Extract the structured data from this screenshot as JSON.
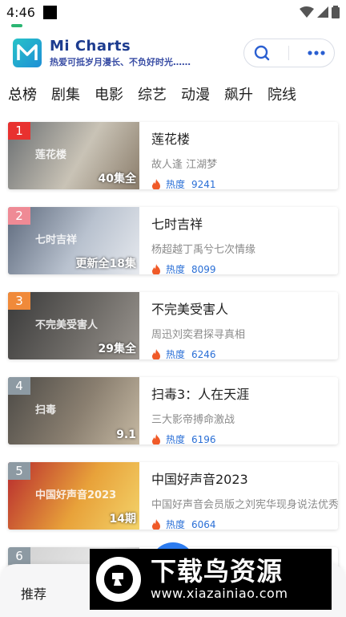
{
  "status": {
    "time": "4:46"
  },
  "header": {
    "app_name": "Mi Charts",
    "tagline": "热爱可抵岁月漫长、不负好时光……",
    "search_icon": "search-icon",
    "more_icon": "more-dots-icon"
  },
  "tabs": [
    {
      "label": "总榜",
      "active": true
    },
    {
      "label": "剧集"
    },
    {
      "label": "电影"
    },
    {
      "label": "综艺"
    },
    {
      "label": "动漫"
    },
    {
      "label": "飙升"
    },
    {
      "label": "院线"
    }
  ],
  "items": [
    {
      "rank": "1",
      "rank_color": "#e8312f",
      "title": "莲花楼",
      "subtitle": "故人逢 江湖梦",
      "episodes": "40集全",
      "heat_label": "热度",
      "heat": "9241",
      "poster_text": "莲花楼",
      "poster_colors": [
        "#6b6f72",
        "#c9c3b6",
        "#8b7d6b"
      ]
    },
    {
      "rank": "2",
      "rank_color": "#ef8a95",
      "title": "七时吉祥",
      "subtitle": "杨超越丁禹兮七次情缘",
      "episodes": "更新全18集",
      "heat_label": "热度",
      "heat": "8099",
      "poster_text": "七时吉祥",
      "poster_colors": [
        "#5e6a7d",
        "#b9c2cf",
        "#e6e9ee"
      ]
    },
    {
      "rank": "3",
      "rank_color": "#f08a3a",
      "title": "不完美受害人",
      "subtitle": "周迅刘奕君探寻真相",
      "episodes": "29集全",
      "heat_label": "热度",
      "heat": "6246",
      "poster_text": "不完美受害人",
      "poster_colors": [
        "#3a3a3a",
        "#6d6a66",
        "#9a958f"
      ]
    },
    {
      "rank": "4",
      "rank_color": "#8d9aa3",
      "title": "扫毒3：人在天涯",
      "subtitle": "三大影帝搏命激战",
      "episodes": "9.1",
      "heat_label": "热度",
      "heat": "6196",
      "poster_text": "扫毒",
      "poster_colors": [
        "#4c4a46",
        "#8a7f70",
        "#c6b9a3"
      ]
    },
    {
      "rank": "5",
      "rank_color": "#8d9aa3",
      "title": "中国好声音2023",
      "subtitle": "中国好声音会员版之刘宪华现身说法优秀",
      "episodes": "14期",
      "heat_label": "热度",
      "heat": "6064",
      "poster_text": "中国好声音2023",
      "poster_colors": [
        "#b82a2e",
        "#e8a23a",
        "#f3d36a"
      ]
    },
    {
      "rank": "6",
      "rank_color": "#8d9aa3"
    }
  ],
  "bottom_nav": {
    "recommend": "推荐"
  },
  "watermark": {
    "name": "下载鸟资源",
    "url": "www.xiazainiao.com"
  }
}
